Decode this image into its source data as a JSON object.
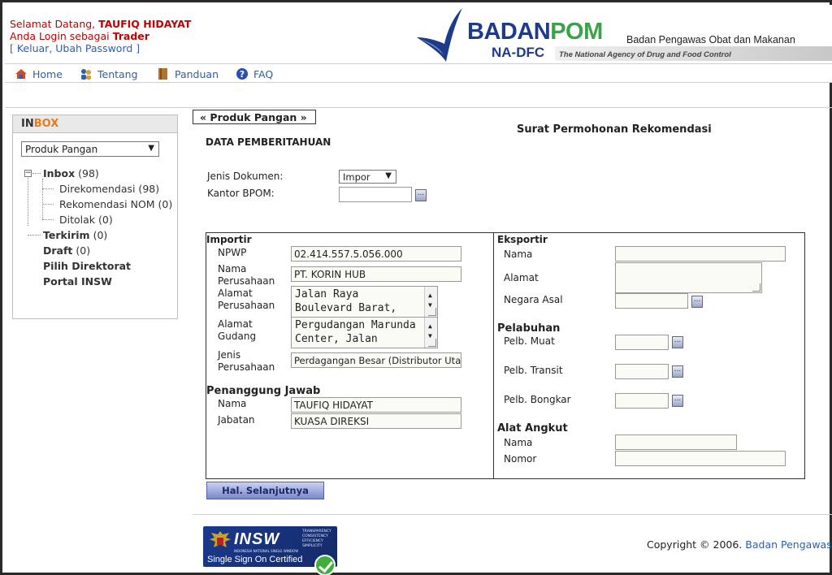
{
  "header": {
    "welcome_prefix": "Selamat Datang, ",
    "user_name": "TAUFIQ HIDAYAT",
    "login_as_prefix": "Anda Login sebagai ",
    "role": "Trader",
    "bracket_open": "[ ",
    "logout": "Keluar",
    "comma": ", ",
    "change_password": "Ubah Password",
    "bracket_close": " ]",
    "logo_badan": "BADAN",
    "logo_pom": "POM",
    "logo_sub": "Badan Pengawas Obat dan Makanan",
    "logo_nadfc": "NA-DFC",
    "logo_eng": "The National Agency of Drug and Food Control"
  },
  "nav": {
    "home": "Home",
    "about": "Tentang",
    "guide": "Panduan",
    "faq": "FAQ"
  },
  "inbox": {
    "title_in": "IN",
    "title_box": "BOX",
    "select_value": "Produk Pangan",
    "tree": {
      "inbox_label": "Inbox",
      "inbox_count": " (98)",
      "direkomendasi": "Direkomendasi (98)",
      "rekomendasi_nom": "Rekomendasi NOM (0)",
      "ditolak": "Ditolak (0)",
      "terkirim_label": "Terkirim",
      "terkirim_count": " (0)",
      "draft_label": "Draft",
      "draft_count": " (0)",
      "pilih_direktorat": "Pilih Direktorat",
      "portal_insw": "Portal INSW"
    }
  },
  "main": {
    "tab_label": "«  Produk Pangan  »",
    "title": "Surat Permohonan Rekomendasi",
    "section": "DATA PEMBERITAHUAN",
    "jenis_dokumen_label": "Jenis Dokumen:",
    "jenis_dokumen_value": "Impor",
    "kantor_bpom_label": "Kantor BPOM:",
    "kantor_bpom_value": ""
  },
  "importir": {
    "title": "Importir",
    "npwp_label": "NPWP",
    "npwp_value": "02.414.557.5.056.000",
    "nama_label_1": "Nama",
    "nama_label_2": "Perusahaan",
    "nama_value": "PT. KORIN HUB",
    "alamat_label_1": "Alamat",
    "alamat_label_2": "Perusahaan",
    "alamat_line1": "Jalan Raya",
    "alamat_line2": "Boulevard Barat,",
    "gudang_label_1": "Alamat",
    "gudang_label_2": "Gudang",
    "gudang_line1": "Pergudangan Marunda",
    "gudang_line2": "Center, Jalan",
    "jenis_label_1": "Jenis",
    "jenis_label_2": "Perusahaan",
    "jenis_value": "Perdagangan Besar (Distributor Utam"
  },
  "penanggung": {
    "title": "Penanggung Jawab",
    "nama_label": "Nama",
    "nama_value": "TAUFIQ HIDAYAT",
    "jabatan_label": "Jabatan",
    "jabatan_value": "KUASA DIREKSI"
  },
  "eksportir": {
    "title": "Eksportir",
    "nama_label": "Nama",
    "nama_value": "",
    "alamat_label": "Alamat",
    "alamat_value": "",
    "negara_label": "Negara Asal",
    "negara_value": ""
  },
  "pelabuhan": {
    "title": "Pelabuhan",
    "muat_label": "Pelb. Muat",
    "transit_label": "Pelb. Transit",
    "bongkar_label": "Pelb. Bongkar"
  },
  "angkut": {
    "title": "Alat Angkut",
    "nama_label": "Nama",
    "nomor_label": "Nomor"
  },
  "buttons": {
    "next": "Hal. Selanjutnya",
    "dots": "..."
  },
  "footer": {
    "insw_logo": "INSW",
    "insw_tag_1": "TRANSPARENCY",
    "insw_tag_2": "CONSISTENCY",
    "insw_tag_3": "EFFICIENCY",
    "insw_tag_4": "SIMPLICITY",
    "insw_sub": "INDONESIA NATIONAL SINGLE WINDOW",
    "sso": "Single Sign On Certified",
    "copyright": "Copyright © 2006. ",
    "copyright_link": "Badan Pengawas"
  },
  "colors": {
    "accent_blue": "#2b5fb0",
    "welcome_red": "#c00000",
    "inbox_orange": "#e87a1b"
  }
}
